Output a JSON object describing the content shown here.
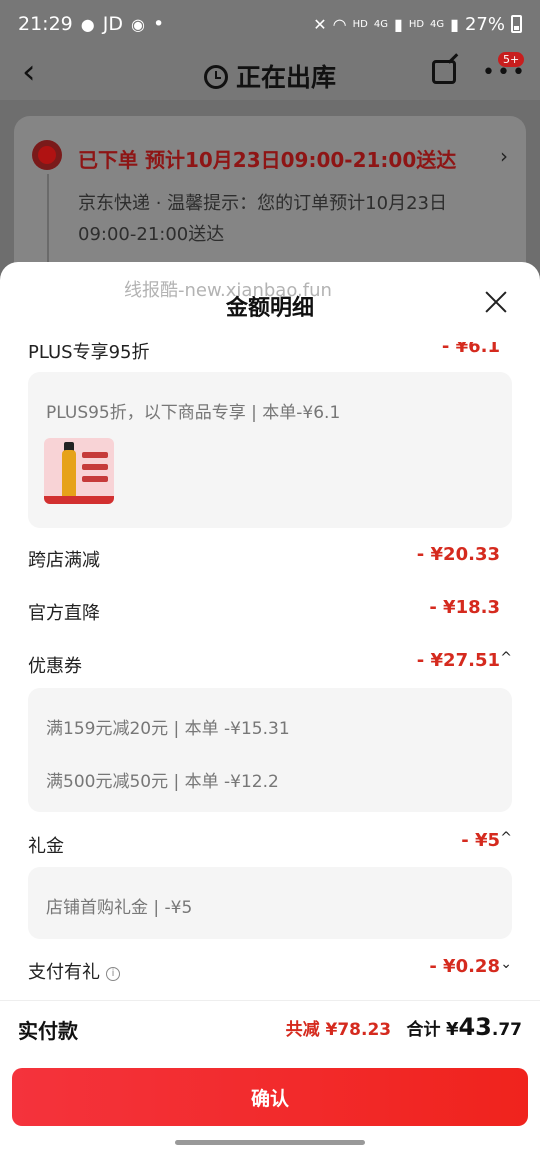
{
  "status_bar": {
    "time": "21:29",
    "apps": "JD",
    "dot": "•",
    "net1": "HD",
    "sig1": "4G",
    "net2": "HD",
    "sig2": "4G",
    "battery": "27%"
  },
  "header": {
    "back": "‹",
    "title": "正在出库",
    "badge": "5+"
  },
  "tracking": {
    "title": "已下单  预计10月23日09:00-21:00送达",
    "chevron": "›",
    "description": "京东快递 · 温馨提示：您的订单预计10月23日09:00-21:00送达"
  },
  "sheet": {
    "watermark": "线报酷-new.xianbao.fun",
    "title": "金额明细",
    "rows": {
      "plus": {
        "label": "PLUS专享95折",
        "amount": "- ¥6.1",
        "chevron": "^"
      },
      "cross_store": {
        "label": "跨店满减",
        "amount": "- ¥20.33"
      },
      "official": {
        "label": "官方直降",
        "amount": "- ¥18.3"
      },
      "coupon": {
        "label": "优惠券",
        "amount": "- ¥27.51",
        "chevron": "^"
      },
      "gift": {
        "label": "礼金",
        "amount": "- ¥5",
        "chevron": "^"
      },
      "pay_gift": {
        "label": "支付有礼",
        "info": "i",
        "amount": "- ¥0.28",
        "chevron": "⌄"
      }
    },
    "plus_box": {
      "line": "PLUS95折，以下商品专享 | 本单-¥6.1"
    },
    "coupon_box": {
      "lines": [
        "满159元减20元 | 本单 -¥15.31",
        "满500元减50元 | 本单 -¥12.2"
      ]
    },
    "gift_box": {
      "line": "店铺首购礼金 | -¥5"
    }
  },
  "summary": {
    "label": "实付款",
    "discount": "共减 ¥78.23",
    "total_label": "合计",
    "yen": "¥",
    "total_int": "43",
    "total_dec": ".77"
  },
  "confirm": {
    "label": "确认"
  }
}
